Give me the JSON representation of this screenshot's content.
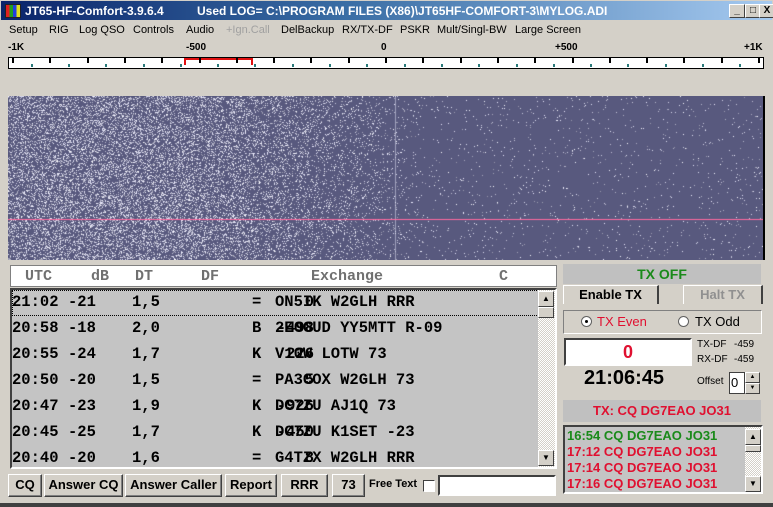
{
  "window": {
    "app_title": "JT65-HF-Comfort-3.9.6.4",
    "log_title": "Used LOG= C:\\PROGRAM FILES (X86)\\JT65HF-COMFORT-3\\MYLOG.ADI",
    "controls": {
      "minimize": "_",
      "maximize": "□",
      "close": "X"
    }
  },
  "menu": [
    {
      "label": "Setup",
      "disabled": false
    },
    {
      "label": "RIG",
      "disabled": false
    },
    {
      "label": "Log QSO",
      "disabled": false
    },
    {
      "label": "Controls",
      "disabled": false
    },
    {
      "label": "Audio",
      "disabled": false
    },
    {
      "label": "+Ign.Call",
      "disabled": true
    },
    {
      "label": "DelBackup",
      "disabled": false
    },
    {
      "label": "RX/TX-DF",
      "disabled": false
    },
    {
      "label": "PSKR",
      "disabled": false
    },
    {
      "label": "Mult/Singl-BW",
      "disabled": false
    },
    {
      "label": "Large Screen",
      "disabled": false
    }
  ],
  "ruler": {
    "labels": [
      "-1K",
      "-500",
      "0",
      "+500",
      "+1K"
    ],
    "range_hz": [
      -1000,
      1000
    ],
    "rx_bracket_hz": [
      -540,
      -355
    ]
  },
  "decode_header": {
    "utc": "UTC",
    "db": "dB",
    "dt": "DT",
    "df": "DF",
    "exchange": "Exchange",
    "c": "C"
  },
  "decodes": [
    {
      "utc": "21:02",
      "db": "-21",
      "dt": "1,5",
      "df": "0",
      "sync": "=",
      "exchange": "ON5IK W2GLH RRR",
      "selected": true
    },
    {
      "utc": "20:58",
      "db": "-18",
      "dt": "2,0",
      "df": "-498",
      "sync": "B",
      "exchange": "2E0GUD YY5MTT R-09"
    },
    {
      "utc": "20:55",
      "db": "-24",
      "dt": "1,7",
      "df": "226",
      "sync": "K",
      "exchange": "V10W LOTW 73"
    },
    {
      "utc": "20:50",
      "db": "-20",
      "dt": "1,5",
      "df": "5",
      "sync": "=",
      "exchange": "PA3COX W2GLH 73"
    },
    {
      "utc": "20:47",
      "db": "-23",
      "dt": "1,9",
      "df": "-926",
      "sync": "K",
      "exchange": "DC7ZU AJ1Q 73"
    },
    {
      "utc": "20:45",
      "db": "-25",
      "dt": "1,7",
      "df": "-450",
      "sync": "K",
      "exchange": "DC7ZU K1SET -23"
    },
    {
      "utc": "20:40",
      "db": "-20",
      "dt": "1,6",
      "df": "8",
      "sync": "=",
      "exchange": "G4TZX W2GLH RRR"
    }
  ],
  "buttons": {
    "cq": "CQ",
    "answer_cq": "Answer CQ",
    "answer_caller": "Answer Caller",
    "report": "Report",
    "rrr": "RRR",
    "seventy_three": "73",
    "free_text_label": "Free Text",
    "free_text_value": ""
  },
  "tx_panel": {
    "status": "TX OFF",
    "enable_tx": "Enable TX",
    "halt_tx": "Halt TX",
    "tx_even": "TX Even",
    "tx_odd": "TX Odd",
    "tx_even_selected": true,
    "counter": "0",
    "tx_df_label": "TX-DF",
    "tx_df_value": "-459",
    "rx_df_label": "RX-DF",
    "rx_df_value": "-459",
    "clock": "21:06:45",
    "offset_label": "Offset",
    "offset_value": "0",
    "tx_message": "TX: CQ DG7EAO JO31",
    "history": [
      {
        "text": "16:54 CQ DG7EAO JO31",
        "color": "#1a8a1a"
      },
      {
        "text": "17:12 CQ DG7EAO JO31",
        "color": "#e01030"
      },
      {
        "text": "17:14 CQ DG7EAO JO31",
        "color": "#e01030"
      },
      {
        "text": "17:16 CQ DG7EAO JO31",
        "color": "#e01030"
      }
    ]
  },
  "colors": {
    "waterfall_bg": "#58597e",
    "rx_line": "#ff6aa0",
    "tx_off": "#1a8a1a",
    "tx_red": "#e01030"
  }
}
